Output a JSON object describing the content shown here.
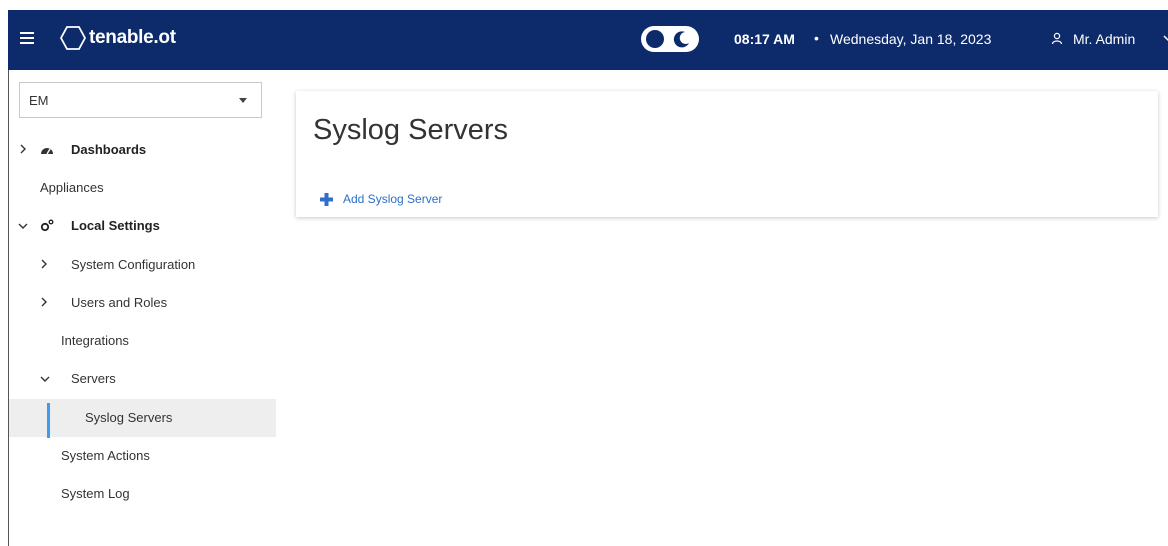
{
  "header": {
    "logo_text": "tenable.ot",
    "time": "08:17 AM",
    "separator": "•",
    "date": "Wednesday, Jan 18, 2023",
    "user": "Mr. Admin"
  },
  "sidebar": {
    "selector_value": "EM",
    "items": [
      {
        "label": "Dashboards"
      },
      {
        "label": "Appliances"
      },
      {
        "label": "Local Settings"
      },
      {
        "label": "System Configuration"
      },
      {
        "label": "Users and Roles"
      },
      {
        "label": "Integrations"
      },
      {
        "label": "Servers"
      },
      {
        "label": "Syslog Servers"
      },
      {
        "label": "System Actions"
      },
      {
        "label": "System Log"
      }
    ]
  },
  "main": {
    "title": "Syslog Servers",
    "add_label": "Add Syslog Server"
  },
  "colors": {
    "header_bg": "#0d2b6b",
    "accent": "#2f6fc7",
    "active_indicator": "#3d9bf0"
  }
}
